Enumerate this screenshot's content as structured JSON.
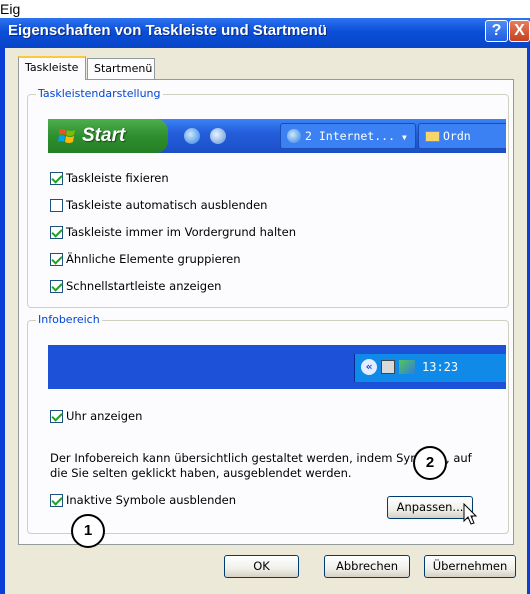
{
  "top_clip_text": "Eig",
  "window": {
    "title": "Eigenschaften von Taskleiste und Startmenü",
    "help_label": "?",
    "close_label": "X"
  },
  "tabs": [
    {
      "label": "Taskleiste",
      "selected": true
    },
    {
      "label": "Startmenü",
      "selected": false
    }
  ],
  "taskbar_group": {
    "legend": "Taskleistendarstellung",
    "preview": {
      "start_label": "Start",
      "task_buttons": [
        "2 Internet...",
        "Ordn"
      ]
    },
    "options": [
      {
        "label": "Taskleiste fixieren",
        "checked": true
      },
      {
        "label": "Taskleiste automatisch ausblenden",
        "checked": false
      },
      {
        "label": "Taskleiste immer im Vordergrund halten",
        "checked": true
      },
      {
        "label": "Ähnliche Elemente gruppieren",
        "checked": true
      },
      {
        "label": "Schnellstartleiste anzeigen",
        "checked": true
      }
    ]
  },
  "notification_group": {
    "legend": "Infobereich",
    "preview": {
      "clock": "13:23",
      "arrow_glyph": "«"
    },
    "show_clock": {
      "label": "Uhr anzeigen",
      "checked": true
    },
    "description": "Der Infobereich kann übersichtlich gestaltet werden, indem Symbole, auf die Sie selten geklickt haben, ausgeblendet werden.",
    "hide_inactive": {
      "label": "Inaktive Symbole ausblenden",
      "checked": true
    },
    "customize_button": "Anpassen..."
  },
  "buttons": {
    "ok": "OK",
    "cancel": "Abbrechen",
    "apply": "Übernehmen"
  },
  "callouts": [
    "1",
    "2"
  ],
  "colors": {
    "title_bar": "#0a4fd8",
    "client_bg": "#ece9d8",
    "legend_text": "#0046d5",
    "start_green": "#2d8f2d",
    "tab_highlight": "#ffc83c"
  }
}
